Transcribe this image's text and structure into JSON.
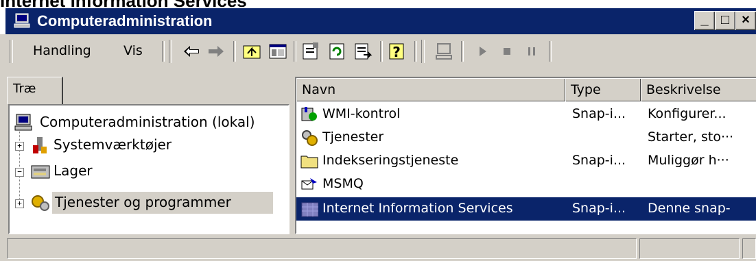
{
  "outer_title": "Internet Information Services",
  "window": {
    "title": "Computeradministration",
    "min": "_",
    "max": "□",
    "close": "×"
  },
  "menu": {
    "handling": "Handling",
    "vis": "Vis"
  },
  "tree": {
    "tab": "Træ",
    "root": "Computeradministration (lokal)",
    "nodes": [
      {
        "label": "Systemværktøjer",
        "expander": "+"
      },
      {
        "label": "Lager",
        "expander": "−"
      },
      {
        "label": "Tjenester og programmer",
        "expander": "+"
      }
    ]
  },
  "list": {
    "columns": [
      "Navn",
      "Type",
      "Beskrivelse"
    ],
    "rows": [
      {
        "name": "WMI-kontrol",
        "type": "Snap-i...",
        "desc": "Konfigurer...",
        "icon": "wmi-icon"
      },
      {
        "name": "Tjenester",
        "type": "",
        "desc": "Starter, sto···",
        "icon": "services-gears-icon"
      },
      {
        "name": "Indekseringstjeneste",
        "type": "Snap-i...",
        "desc": "Muliggør h···",
        "icon": "folder-icon"
      },
      {
        "name": "MSMQ",
        "type": "",
        "desc": "",
        "icon": "msmq-icon"
      },
      {
        "name": "Internet Information Services",
        "type": "Snap-i...",
        "desc": "Denne snap-",
        "icon": "iis-icon"
      }
    ],
    "selected_index": 4
  },
  "colors": {
    "titlebar": "#0a246a",
    "face": "#d4d0c8",
    "selection": "#0a246a"
  }
}
